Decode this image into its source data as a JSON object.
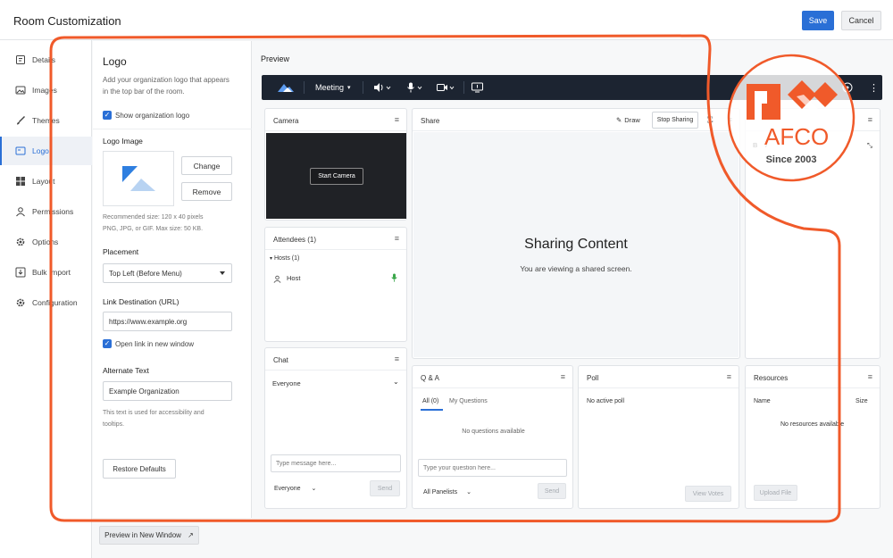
{
  "app": {
    "title": "Room Customization",
    "save_label": "Save",
    "cancel_label": "Cancel"
  },
  "sidebar": {
    "items": [
      {
        "label": "Details",
        "icon": "details-icon"
      },
      {
        "label": "Images",
        "icon": "image-icon"
      },
      {
        "label": "Themes",
        "icon": "brush-icon"
      },
      {
        "label": "Logo",
        "icon": "logo-icon",
        "active": true
      },
      {
        "label": "Layout",
        "icon": "layout-icon"
      },
      {
        "label": "Permissions",
        "icon": "user-icon"
      },
      {
        "label": "Options",
        "icon": "gear-icon"
      },
      {
        "label": "Bulk Import",
        "icon": "import-icon"
      },
      {
        "label": "Configuration",
        "icon": "gear-icon"
      }
    ]
  },
  "logo_settings": {
    "title": "Logo",
    "description": "Add your organization logo that appears in the top bar of the room.",
    "show_logo_label": "Show organization logo",
    "logo_image_label": "Logo Image",
    "change_label": "Change",
    "remove_label": "Remove",
    "size_hint_1": "Recommended size: 120 x 40 pixels",
    "size_hint_2": "PNG, JPG, or GIF. Max size: 50 KB.",
    "placement_label": "Placement",
    "placement_value": "Top Left (Before Menu)",
    "link_label": "Link Destination (URL)",
    "link_value": "https://www.example.org",
    "new_window_label": "Open link in new window",
    "alt_text_label": "Alternate Text",
    "alt_text_value": "Example Organization",
    "alt_hint": "This text is used for accessibility and tooltips.",
    "restore_label": "Restore Defaults",
    "preview_window_label": "Preview in New Window"
  },
  "preview": {
    "title": "Preview",
    "toolbar": {
      "meeting_label": "Meeting"
    },
    "camera": {
      "title": "Camera",
      "start_label": "Start Camera"
    },
    "share": {
      "title": "Share",
      "draw_label": "Draw",
      "stop_label": "Stop Sharing",
      "heading": "Sharing Content",
      "subtext": "You are viewing a shared screen."
    },
    "attendees": {
      "title": "Attendees",
      "count": "(1)",
      "hosts_label": "Hosts (1)",
      "host_name": "Host"
    },
    "chat": {
      "title": "Chat",
      "to_value": "Everyone",
      "placeholder": "Type message here...",
      "audience_value": "Everyone",
      "send_label": "Send"
    },
    "qa": {
      "title": "Q & A",
      "tab_all": "All (0)",
      "tab_mine": "My Questions",
      "empty": "No questions available",
      "placeholder": "Type your question here...",
      "audience_value": "All Panelists",
      "send_label": "Send"
    },
    "poll": {
      "title": "Poll",
      "empty": "No active poll",
      "view_votes_label": "View Votes"
    },
    "resources": {
      "title": "Resources",
      "col_name": "Name",
      "col_size": "Size",
      "empty": "No resources available",
      "upload_label": "Upload File"
    }
  },
  "watermark": {
    "brand_letters": "AFCO",
    "since": "Since 2003"
  },
  "colors": {
    "accent": "#2a6fd6",
    "toolbar_bg": "#1c2431",
    "annotation": "#f05a2a"
  }
}
